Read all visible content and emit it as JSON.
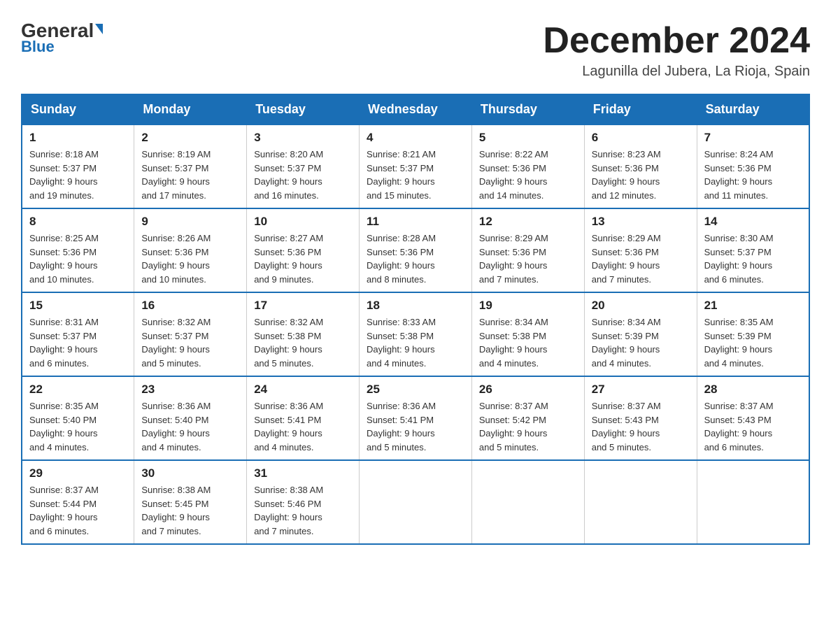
{
  "header": {
    "logo_general": "General",
    "logo_blue": "Blue",
    "month_title": "December 2024",
    "location": "Lagunilla del Jubera, La Rioja, Spain"
  },
  "days_of_week": [
    "Sunday",
    "Monday",
    "Tuesday",
    "Wednesday",
    "Thursday",
    "Friday",
    "Saturday"
  ],
  "weeks": [
    [
      {
        "day": "1",
        "sunrise": "8:18 AM",
        "sunset": "5:37 PM",
        "daylight": "9 hours and 19 minutes."
      },
      {
        "day": "2",
        "sunrise": "8:19 AM",
        "sunset": "5:37 PM",
        "daylight": "9 hours and 17 minutes."
      },
      {
        "day": "3",
        "sunrise": "8:20 AM",
        "sunset": "5:37 PM",
        "daylight": "9 hours and 16 minutes."
      },
      {
        "day": "4",
        "sunrise": "8:21 AM",
        "sunset": "5:37 PM",
        "daylight": "9 hours and 15 minutes."
      },
      {
        "day": "5",
        "sunrise": "8:22 AM",
        "sunset": "5:36 PM",
        "daylight": "9 hours and 14 minutes."
      },
      {
        "day": "6",
        "sunrise": "8:23 AM",
        "sunset": "5:36 PM",
        "daylight": "9 hours and 12 minutes."
      },
      {
        "day": "7",
        "sunrise": "8:24 AM",
        "sunset": "5:36 PM",
        "daylight": "9 hours and 11 minutes."
      }
    ],
    [
      {
        "day": "8",
        "sunrise": "8:25 AM",
        "sunset": "5:36 PM",
        "daylight": "9 hours and 10 minutes."
      },
      {
        "day": "9",
        "sunrise": "8:26 AM",
        "sunset": "5:36 PM",
        "daylight": "9 hours and 10 minutes."
      },
      {
        "day": "10",
        "sunrise": "8:27 AM",
        "sunset": "5:36 PM",
        "daylight": "9 hours and 9 minutes."
      },
      {
        "day": "11",
        "sunrise": "8:28 AM",
        "sunset": "5:36 PM",
        "daylight": "9 hours and 8 minutes."
      },
      {
        "day": "12",
        "sunrise": "8:29 AM",
        "sunset": "5:36 PM",
        "daylight": "9 hours and 7 minutes."
      },
      {
        "day": "13",
        "sunrise": "8:29 AM",
        "sunset": "5:36 PM",
        "daylight": "9 hours and 7 minutes."
      },
      {
        "day": "14",
        "sunrise": "8:30 AM",
        "sunset": "5:37 PM",
        "daylight": "9 hours and 6 minutes."
      }
    ],
    [
      {
        "day": "15",
        "sunrise": "8:31 AM",
        "sunset": "5:37 PM",
        "daylight": "9 hours and 6 minutes."
      },
      {
        "day": "16",
        "sunrise": "8:32 AM",
        "sunset": "5:37 PM",
        "daylight": "9 hours and 5 minutes."
      },
      {
        "day": "17",
        "sunrise": "8:32 AM",
        "sunset": "5:38 PM",
        "daylight": "9 hours and 5 minutes."
      },
      {
        "day": "18",
        "sunrise": "8:33 AM",
        "sunset": "5:38 PM",
        "daylight": "9 hours and 4 minutes."
      },
      {
        "day": "19",
        "sunrise": "8:34 AM",
        "sunset": "5:38 PM",
        "daylight": "9 hours and 4 minutes."
      },
      {
        "day": "20",
        "sunrise": "8:34 AM",
        "sunset": "5:39 PM",
        "daylight": "9 hours and 4 minutes."
      },
      {
        "day": "21",
        "sunrise": "8:35 AM",
        "sunset": "5:39 PM",
        "daylight": "9 hours and 4 minutes."
      }
    ],
    [
      {
        "day": "22",
        "sunrise": "8:35 AM",
        "sunset": "5:40 PM",
        "daylight": "9 hours and 4 minutes."
      },
      {
        "day": "23",
        "sunrise": "8:36 AM",
        "sunset": "5:40 PM",
        "daylight": "9 hours and 4 minutes."
      },
      {
        "day": "24",
        "sunrise": "8:36 AM",
        "sunset": "5:41 PM",
        "daylight": "9 hours and 4 minutes."
      },
      {
        "day": "25",
        "sunrise": "8:36 AM",
        "sunset": "5:41 PM",
        "daylight": "9 hours and 5 minutes."
      },
      {
        "day": "26",
        "sunrise": "8:37 AM",
        "sunset": "5:42 PM",
        "daylight": "9 hours and 5 minutes."
      },
      {
        "day": "27",
        "sunrise": "8:37 AM",
        "sunset": "5:43 PM",
        "daylight": "9 hours and 5 minutes."
      },
      {
        "day": "28",
        "sunrise": "8:37 AM",
        "sunset": "5:43 PM",
        "daylight": "9 hours and 6 minutes."
      }
    ],
    [
      {
        "day": "29",
        "sunrise": "8:37 AM",
        "sunset": "5:44 PM",
        "daylight": "9 hours and 6 minutes."
      },
      {
        "day": "30",
        "sunrise": "8:38 AM",
        "sunset": "5:45 PM",
        "daylight": "9 hours and 7 minutes."
      },
      {
        "day": "31",
        "sunrise": "8:38 AM",
        "sunset": "5:46 PM",
        "daylight": "9 hours and 7 minutes."
      },
      null,
      null,
      null,
      null
    ]
  ]
}
